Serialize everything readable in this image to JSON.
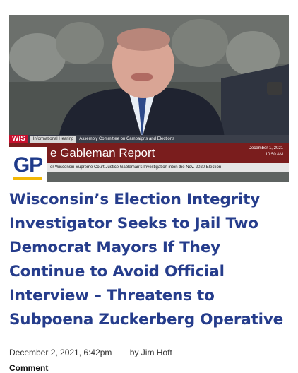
{
  "hero": {
    "channel_logo": "WIS",
    "info_tag": "Informational Hearing",
    "info_sub": "Assembly Committee on Campaigns and Elections",
    "chyron_title": "e Gableman Report",
    "chyron_date": "December 1, 2021",
    "chyron_time": "10:50 AM",
    "chyron_bottom": "er Wisconsin Supreme Court Justice Gableman's Investigation inton the Nov. 2020 Election"
  },
  "badge": {
    "text": "GP",
    "text_color": "#1e3a8a",
    "underline_color": "#f2b705"
  },
  "article": {
    "title": "Wisconsin’s Election Integrity Investigator Seeks to Jail Two Democrat Mayors If They Continue to Avoid Official Interview – Threatens to Subpoena Zuckerberg Operative",
    "date": "December 2, 2021, 6:42pm",
    "byline": "by Jim Hoft",
    "comment_label": "Comment"
  },
  "colors": {
    "headline": "#263d8c",
    "chyron_red": "#7a1d1d"
  }
}
